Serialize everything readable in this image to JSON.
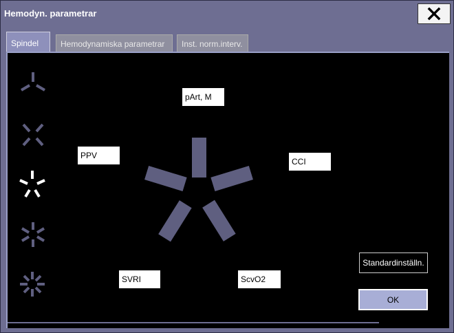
{
  "window": {
    "title": "Hemodyn. parametrar",
    "close_icon": "close-icon"
  },
  "tabs": [
    {
      "label": "Spindel",
      "active": true
    },
    {
      "label": "Hemodynamiska parametrar",
      "active": false
    },
    {
      "label": "Inst. norm.interv.",
      "active": false
    }
  ],
  "shape_options": [
    {
      "name": "3-spoke",
      "spokes": 3,
      "selected": false
    },
    {
      "name": "4-spoke",
      "spokes": 4,
      "selected": false
    },
    {
      "name": "5-spoke",
      "spokes": 5,
      "selected": true
    },
    {
      "name": "6-spoke",
      "spokes": 6,
      "selected": false
    },
    {
      "name": "8-spoke",
      "spokes": 8,
      "selected": false
    }
  ],
  "parameters": {
    "top": "pArt, M",
    "upper_right": "CCI",
    "lower_right": "ScvO2",
    "lower_left": "SVRI",
    "upper_left": "PPV"
  },
  "buttons": {
    "default_label": "Standardinställn.",
    "ok_label": "OK"
  },
  "colors": {
    "spoke": "#5f5f80",
    "selected_icon": "#ffffff",
    "accent": "#8e90bb"
  }
}
